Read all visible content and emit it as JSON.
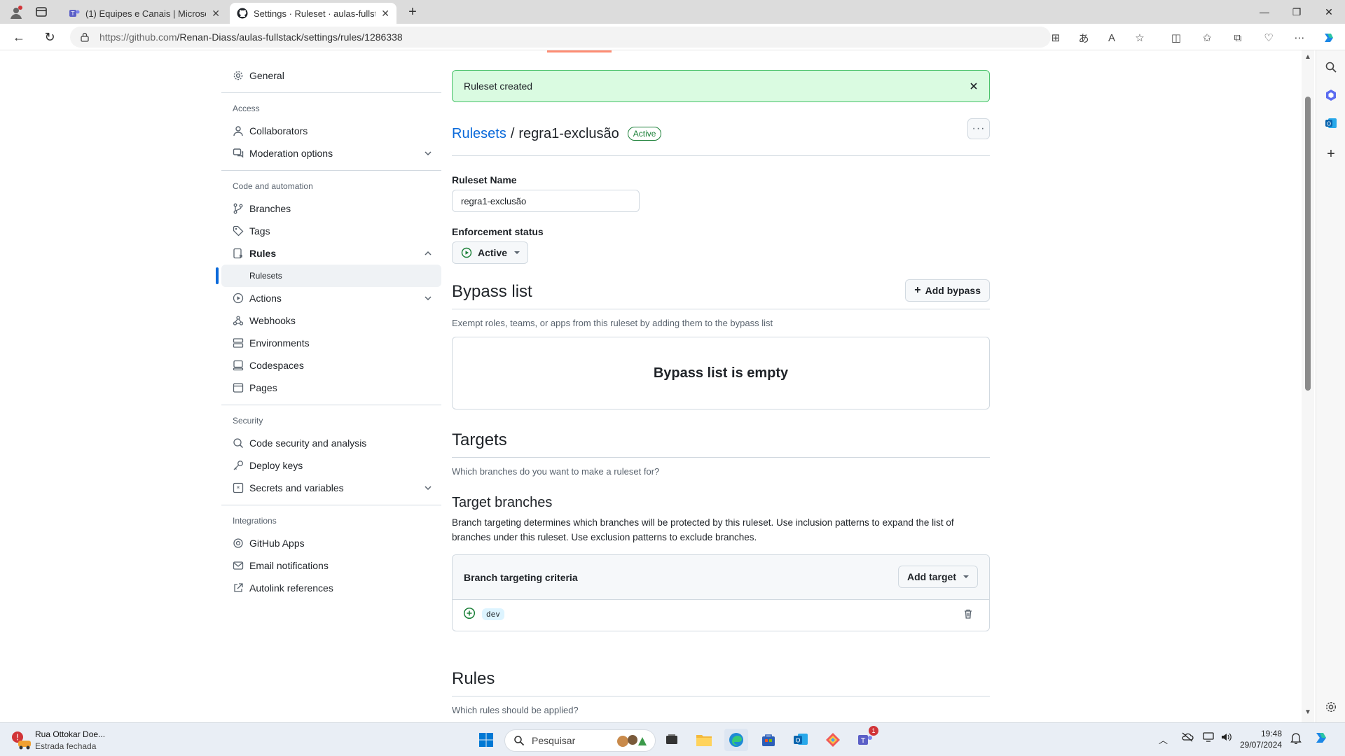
{
  "browser": {
    "tabs": [
      {
        "label": "(1) Equipes e Canais | Microsoft T",
        "active": false,
        "icon": "teams-icon"
      },
      {
        "label": "Settings · Ruleset · aulas-fullstack",
        "active": true,
        "icon": "github-icon"
      }
    ],
    "url_host": "https://github.com",
    "url_path": "/Renan-Diass/aulas-fullstack/settings/rules/1286338"
  },
  "sidebar": {
    "general": "General",
    "access_heading": "Access",
    "collaborators": "Collaborators",
    "moderation": "Moderation options",
    "code_heading": "Code and automation",
    "branches": "Branches",
    "tags": "Tags",
    "rules": "Rules",
    "rulesets": "Rulesets",
    "actions": "Actions",
    "webhooks": "Webhooks",
    "environments": "Environments",
    "codespaces": "Codespaces",
    "pages": "Pages",
    "security_heading": "Security",
    "code_security": "Code security and analysis",
    "deploy_keys": "Deploy keys",
    "secrets": "Secrets and variables",
    "integrations_heading": "Integrations",
    "github_apps": "GitHub Apps",
    "email_notifications": "Email notifications",
    "autolink": "Autolink references"
  },
  "flash": {
    "message": "Ruleset created"
  },
  "header": {
    "crumb_link": "Rulesets",
    "separator": "/",
    "ruleset_name": "regra1-exclusão",
    "status_badge": "Active"
  },
  "form": {
    "name_label": "Ruleset Name",
    "name_value": "regra1-exclusão",
    "enforcement_label": "Enforcement status",
    "enforcement_value": "Active"
  },
  "bypass": {
    "title": "Bypass list",
    "add_button": "Add bypass",
    "description": "Exempt roles, teams, or apps from this ruleset by adding them to the bypass list",
    "empty": "Bypass list is empty"
  },
  "targets": {
    "title": "Targets",
    "description": "Which branches do you want to make a ruleset for?",
    "branches_title": "Target branches",
    "branches_desc": "Branch targeting determines which branches will be protected by this ruleset. Use inclusion patterns to expand the list of branches under this ruleset. Use exclusion patterns to exclude branches.",
    "criteria_label": "Branch targeting criteria",
    "add_target": "Add target",
    "pattern": "dev"
  },
  "rules_section": {
    "title": "Rules",
    "description": "Which rules should be applied?"
  },
  "taskbar": {
    "notification_title": "Rua Ottokar Doe...",
    "notification_sub": "Estrada fechada",
    "search_placeholder": "Pesquisar",
    "time": "19:48",
    "date": "29/07/2024",
    "teams_badge": "1"
  },
  "colors": {
    "accent": "#0969da",
    "success": "#1a7f37",
    "flash_bg": "#dafbe1"
  }
}
